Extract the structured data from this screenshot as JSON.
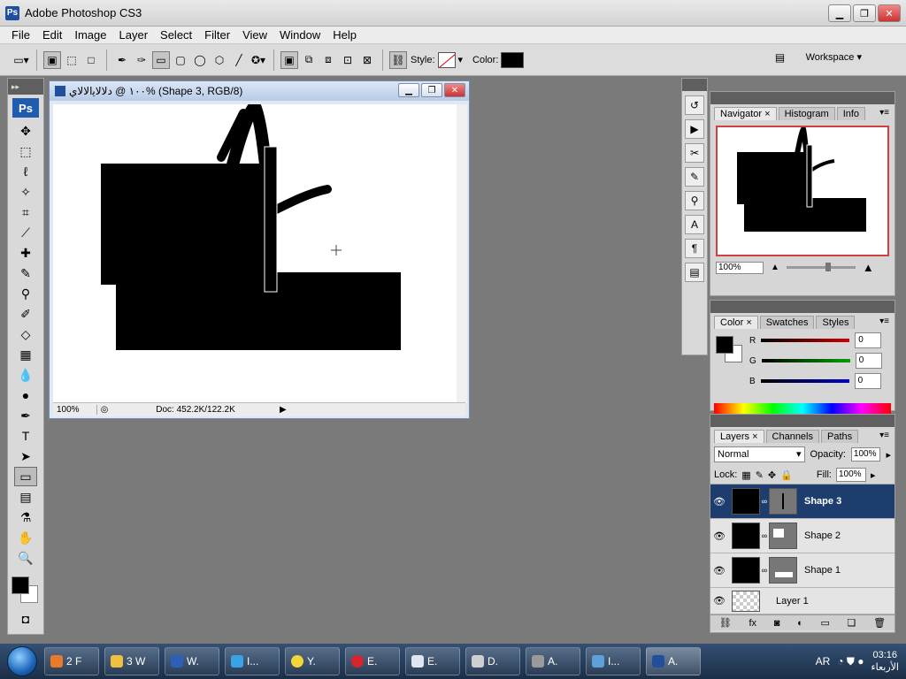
{
  "app": {
    "title": "Adobe Photoshop CS3",
    "logo": "Ps"
  },
  "menu": [
    "File",
    "Edit",
    "Image",
    "Layer",
    "Select",
    "Filter",
    "View",
    "Window",
    "Help"
  ],
  "options": {
    "style_label": "Style:",
    "color_label": "Color:",
    "workspace_label": "Workspace",
    "fill_color": "#000000"
  },
  "toolbox": {
    "logo": "Ps"
  },
  "document": {
    "title": "١٠٠ @ ﺩﻻﻻﻳﺍﻻﻻﻱ% (Shape 3, RGB/8)",
    "zoom": "100%",
    "doc_info": "Doc: 452.2K/122.2K"
  },
  "navigator": {
    "tabs": [
      "Navigator",
      "Histogram",
      "Info"
    ],
    "zoom": "100%"
  },
  "color_panel": {
    "tabs": [
      "Color",
      "Swatches",
      "Styles"
    ],
    "channels": [
      {
        "label": "R",
        "value": "0",
        "color": "#d00000"
      },
      {
        "label": "G",
        "value": "0",
        "color": "#00a000"
      },
      {
        "label": "B",
        "value": "0",
        "color": "#0000c8"
      }
    ]
  },
  "layers_panel": {
    "tabs": [
      "Layers",
      "Channels",
      "Paths"
    ],
    "blend_mode": "Normal",
    "opacity_label": "Opacity:",
    "opacity": "100%",
    "lock_label": "Lock:",
    "fill_label": "Fill:",
    "fill": "100%",
    "layers": [
      {
        "name": "Shape 3",
        "selected": true
      },
      {
        "name": "Shape 2",
        "selected": false
      },
      {
        "name": "Shape 1",
        "selected": false
      },
      {
        "name": "Layer 1",
        "selected": false
      }
    ]
  },
  "taskbar": {
    "tasks": [
      {
        "label": "2 F",
        "icon": "firefox-icon"
      },
      {
        "label": "3 W",
        "icon": "windows-explorer-icon"
      },
      {
        "label": "W.",
        "icon": "word-icon"
      },
      {
        "label": "I...",
        "icon": "internet-explorer-icon"
      },
      {
        "label": "Y.",
        "icon": "messenger-icon"
      },
      {
        "label": "E.",
        "icon": "opera-icon"
      },
      {
        "label": "E.",
        "icon": "document-icon"
      },
      {
        "label": "D.",
        "icon": "paint-icon"
      },
      {
        "label": "A.",
        "icon": "app-icon"
      },
      {
        "label": "I...",
        "icon": "network-icon"
      },
      {
        "label": "A.",
        "icon": "photoshop-icon"
      }
    ],
    "language": "AR",
    "time": "03:16",
    "day": "الأربعاء"
  }
}
